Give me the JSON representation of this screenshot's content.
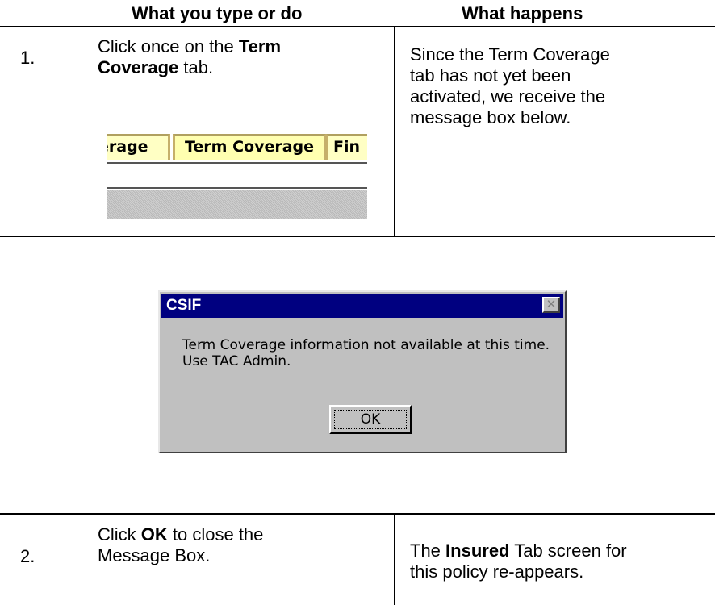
{
  "table": {
    "headers": [
      "What you type or do",
      "What happens"
    ]
  },
  "step1": {
    "number": "1.",
    "action_parts": [
      "Click once on the ",
      "Term",
      "Coverage",
      " tab."
    ],
    "result_lines": [
      "Since the Term Coverage",
      "tab has not yet been",
      "activated, we receive the",
      "message box below."
    ]
  },
  "tabs": [
    "erage",
    "Term Coverage",
    "Fin"
  ],
  "dialog": {
    "title": "CSIF",
    "close_symbol": "✕",
    "message_lines": [
      "Term Coverage information not available at this time.",
      "Use TAC Admin."
    ],
    "ok_label": "OK"
  },
  "step2": {
    "number": "2.",
    "action_parts": [
      "Click ",
      "OK",
      " to close the",
      "Message Box."
    ],
    "result_parts": [
      "The ",
      "Insured",
      " Tab screen for",
      "this policy re-appears."
    ]
  }
}
